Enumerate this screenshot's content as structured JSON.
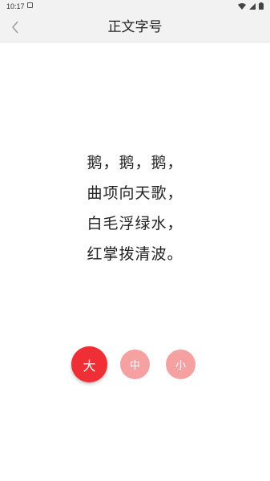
{
  "status_bar": {
    "time": "10:17",
    "icons": [
      "notification-icon",
      "wifi-icon",
      "signal-icon",
      "battery-icon"
    ]
  },
  "header": {
    "title": "正文字号",
    "back_icon": "chevron-left-icon"
  },
  "poem": {
    "lines": [
      "鹅，鹅，鹅，",
      "曲项向天歌，",
      "白毛浮绿水，",
      "红掌拨清波。"
    ]
  },
  "font_size_options": {
    "selected": "大",
    "buttons": [
      {
        "label": "大"
      },
      {
        "label": "中"
      },
      {
        "label": "小"
      }
    ]
  },
  "colors": {
    "selected": "#f02e35",
    "unselected": "#f6a1a1",
    "header_bg": "#f2f2f2"
  }
}
